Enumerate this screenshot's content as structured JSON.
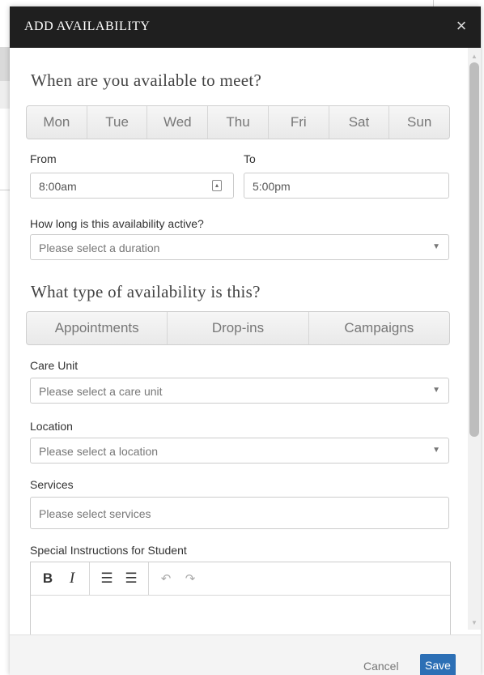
{
  "modal": {
    "title": "ADD AVAILABILITY",
    "close_symbol": "×"
  },
  "schedule": {
    "heading": "When are you available to meet?",
    "days": [
      "Mon",
      "Tue",
      "Wed",
      "Thu",
      "Fri",
      "Sat",
      "Sun"
    ],
    "from_label": "From",
    "from_value": "8:00am",
    "to_label": "To",
    "to_value": "5:00pm",
    "duration_label": "How long is this availability active?",
    "duration_placeholder": "Please select a duration"
  },
  "availability_type": {
    "heading": "What type of availability is this?",
    "options": [
      "Appointments",
      "Drop-ins",
      "Campaigns"
    ]
  },
  "care_unit": {
    "label": "Care Unit",
    "placeholder": "Please select a care unit"
  },
  "location": {
    "label": "Location",
    "placeholder": "Please select a location"
  },
  "services": {
    "label": "Services",
    "placeholder": "Please select services"
  },
  "instructions": {
    "label": "Special Instructions for Student",
    "toolbar": {
      "bold": "B",
      "italic": "I",
      "bullet_list": "☰",
      "numbered_list": "☰",
      "undo": "↶",
      "redo": "↷"
    }
  },
  "footer": {
    "cancel_label": "Cancel",
    "save_label": "Save"
  },
  "colors": {
    "header_bg": "#1f1f1f",
    "primary": "#2c6fb5"
  }
}
